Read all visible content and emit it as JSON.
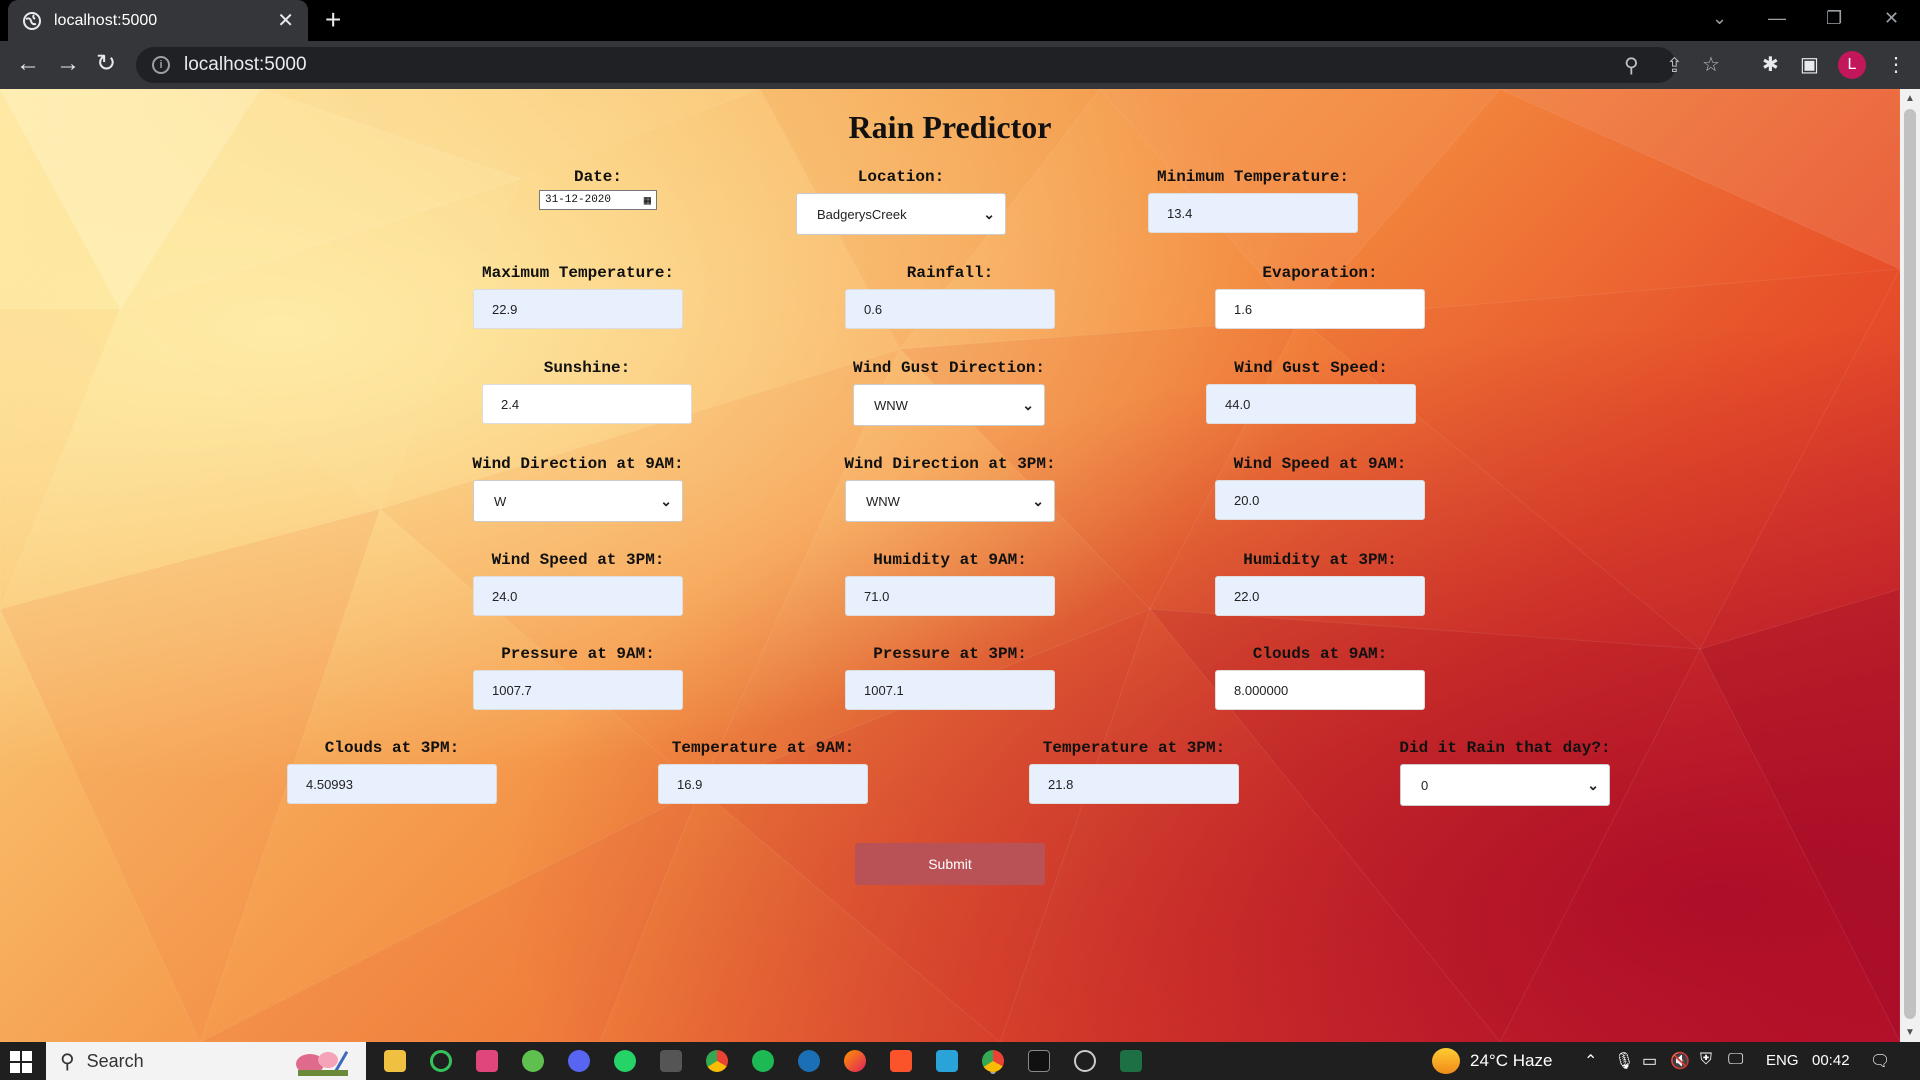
{
  "browser": {
    "tab_title": "localhost:5000",
    "url": "localhost:5000"
  },
  "page": {
    "title": "Rain Predictor",
    "submit_label": "Submit"
  },
  "fields": {
    "date": {
      "label": "Date:",
      "value": "31-12-2020"
    },
    "location": {
      "label": "Location:",
      "value": "BadgerysCreek"
    },
    "min_temp": {
      "label": "Minimum Temperature:",
      "value": "13.4"
    },
    "max_temp": {
      "label": "Maximum Temperature:",
      "value": "22.9"
    },
    "rainfall": {
      "label": "Rainfall:",
      "value": "0.6"
    },
    "evaporation": {
      "label": "Evaporation:",
      "value": "1.6"
    },
    "sunshine": {
      "label": "Sunshine:",
      "value": "2.4"
    },
    "wind_gust_dir": {
      "label": "Wind Gust Direction:",
      "value": "WNW"
    },
    "wind_gust_speed": {
      "label": "Wind Gust Speed:",
      "value": "44.0"
    },
    "wind_dir_9am": {
      "label": "Wind Direction at 9AM:",
      "value": "W"
    },
    "wind_dir_3pm": {
      "label": "Wind Direction at 3PM:",
      "value": "WNW"
    },
    "wind_speed_9am": {
      "label": "Wind Speed at 9AM:",
      "value": "20.0"
    },
    "wind_speed_3pm": {
      "label": "Wind Speed at 3PM:",
      "value": "24.0"
    },
    "humidity_9am": {
      "label": "Humidity at 9AM:",
      "value": "71.0"
    },
    "humidity_3pm": {
      "label": "Humidity at 3PM:",
      "value": "22.0"
    },
    "pressure_9am": {
      "label": "Pressure at 9AM:",
      "value": "1007.7"
    },
    "pressure_3pm": {
      "label": "Pressure at 3PM:",
      "value": "1007.1"
    },
    "clouds_9am": {
      "label": "Clouds at 9AM:",
      "value": "8.000000"
    },
    "clouds_3pm": {
      "label": "Clouds at 3PM:",
      "value": "4.50993"
    },
    "temp_9am": {
      "label": "Temperature at 9AM:",
      "value": "16.9"
    },
    "temp_3pm": {
      "label": "Temperature at 3PM:",
      "value": "21.8"
    },
    "rain_today": {
      "label": "Did it Rain that day?:",
      "value": "0"
    }
  },
  "taskbar": {
    "search_placeholder": "Search",
    "weather": "24°C Haze",
    "language": "ENG",
    "time": "00:42"
  },
  "colors": {
    "submit": "#b85256",
    "input_fill": "#e8f0fe"
  }
}
